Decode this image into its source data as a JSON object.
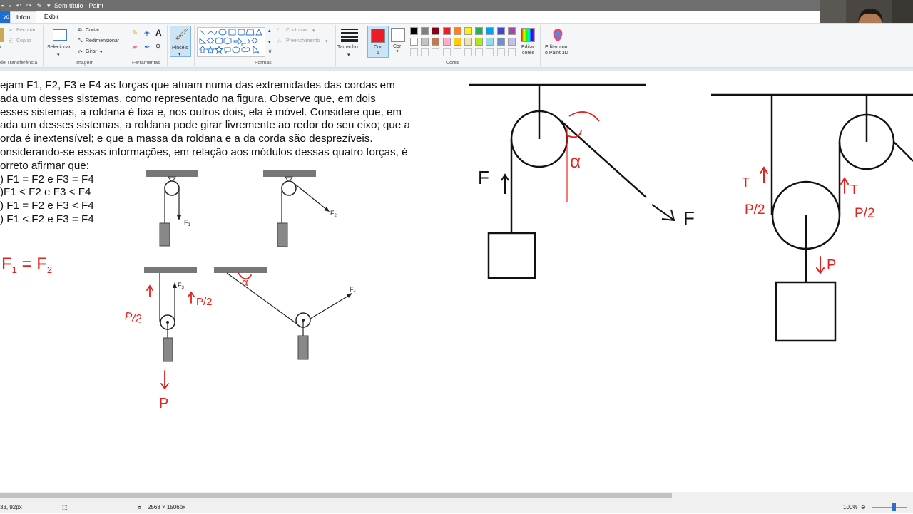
{
  "window": {
    "title": "Sem título - Paint"
  },
  "tabs": {
    "file": "vo",
    "home": "Início",
    "view": "Exibir"
  },
  "ribbon": {
    "clipboard": {
      "cut": "Recortar",
      "copy": "Copiar",
      "label": "de Transferência"
    },
    "image": {
      "select": "Selecionar",
      "crop": "Cortar",
      "resize": "Redimensionar",
      "rotate": "Girar",
      "label": "Imagem"
    },
    "tools": {
      "label": "Ferramentas"
    },
    "brushes": {
      "label": "Pincéis"
    },
    "shapes": {
      "outline": "Contorno",
      "fill": "Preenchimento",
      "label": "Formas"
    },
    "size": {
      "label": "Tamanho"
    },
    "colors": {
      "color1": "Cor",
      "color1_num": "1",
      "color2": "Cor",
      "color2_num": "2",
      "edit": "Editar",
      "edit2": "cores",
      "paint3d": "Editar com",
      "paint3d2": "o Paint 3D",
      "label": "Cores",
      "active_color": "#ed1c24",
      "palette_row1": [
        "#000000",
        "#7f7f7f",
        "#880015",
        "#ed1c24",
        "#ff7f27",
        "#fff200",
        "#22b14c",
        "#00a2e8",
        "#3f48cc",
        "#a349a4"
      ],
      "palette_row2": [
        "#ffffff",
        "#c3c3c3",
        "#b97a57",
        "#ffaec9",
        "#ffc90e",
        "#efe4b0",
        "#b5e61d",
        "#99d9ea",
        "#7092be",
        "#c8bfe7"
      ]
    }
  },
  "problem": {
    "lines": [
      "ejam F1, F2, F3 e F4 as forças que atuam numa das extremidades das cordas em",
      "ada um desses sistemas, como representado na figura. Observe que, em dois",
      "esses sistemas, a roldana é fixa e, nos outros dois, ela é móvel. Considere que, em",
      "ada um desses sistemas, a roldana pode girar livremente ao redor do seu eixo; que a",
      "orda é inextensível; e que a massa da roldana e a da corda são desprezíveis.",
      "onsiderando-se essas informações, em relação aos módulos dessas quatro forças, é",
      "orreto afirmar que:"
    ],
    "options": [
      ") F1 = F2 e F3 = F4",
      ")F1 < F2 e F3 < F4",
      ") F1 = F2 e F3 < F4",
      ") F1 < F2 e F3 = F4"
    ]
  },
  "figure_labels": {
    "f1": "F",
    "f1_sub": "1",
    "f2": "F",
    "f2_sub": "2",
    "f3": "F",
    "f3_sub": "3",
    "f4": "F",
    "f4_sub": "4"
  },
  "annotations": {
    "eq_left": "F",
    "eq_sub1": "1",
    "eq_mid": " = F",
    "eq_sub2": "2",
    "p_half": "P/2",
    "p": "P",
    "alpha": "α",
    "force": "F",
    "tension": "T",
    "annotation_color": "#e8201c"
  },
  "statusbar": {
    "position": "33, 92px",
    "dimensions": "2568 × 1506px",
    "zoom": "100%"
  }
}
